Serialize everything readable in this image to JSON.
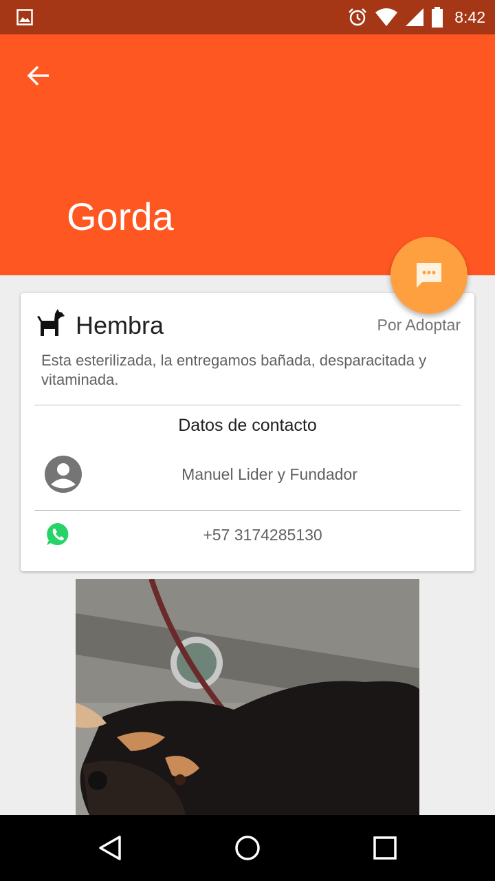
{
  "status_bar": {
    "time": "8:42"
  },
  "header": {
    "title": "Gorda"
  },
  "pet": {
    "gender": "Hembra",
    "status": "Por Adoptar",
    "description": "Esta esterilizada, la entregamos bañada, desparacitada y vitaminada."
  },
  "contact": {
    "heading": "Datos de contacto",
    "name": "Manuel Lider y Fundador",
    "phone": "+57 3174285130"
  },
  "colors": {
    "primary": "#ff5722",
    "status_bar": "#a63716",
    "fab": "#ffa040",
    "whatsapp": "#25d366"
  },
  "icons": {
    "status": [
      "image-icon",
      "alarm-icon",
      "wifi-icon",
      "signal-icon",
      "battery-icon"
    ],
    "header": "arrow-back-icon",
    "fab": "chat-icon",
    "card": [
      "dog-icon",
      "person-icon",
      "whatsapp-icon"
    ],
    "nav": [
      "back-triangle-icon",
      "home-circle-icon",
      "recents-square-icon"
    ]
  }
}
